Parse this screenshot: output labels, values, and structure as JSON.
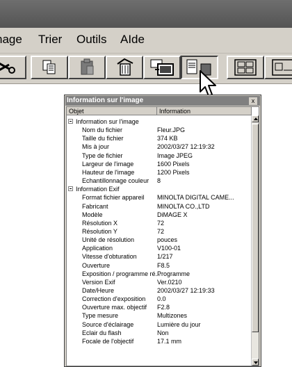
{
  "menu": {
    "items": [
      "nage",
      "Trier",
      "Outils",
      "AIde"
    ]
  },
  "dialog": {
    "title": "Information sur l'image",
    "close": "x",
    "columns": [
      "Objet",
      "Information"
    ],
    "rows": [
      {
        "group": true,
        "name": "Information sur l'image",
        "value": ""
      },
      {
        "name": "Nom du fichier",
        "value": "Fleur.JPG"
      },
      {
        "name": "Taille du fichier",
        "value": "374 KB"
      },
      {
        "name": "Mis à jour",
        "value": "2002/03/27 12:19:32"
      },
      {
        "name": "Type de fichier",
        "value": "Image JPEG"
      },
      {
        "name": "Largeur de l'image",
        "value": "1600 Pixels"
      },
      {
        "name": "Hauteur de l'image",
        "value": "1200 Pixels"
      },
      {
        "name": "Echantillonnage couleur",
        "value": "8"
      },
      {
        "group": true,
        "name": "Information Exif",
        "value": ""
      },
      {
        "name": "Format fichier appareil",
        "value": "MINOLTA DIGITAL CAME..."
      },
      {
        "name": "Fabricant",
        "value": "MINOLTA CO.,LTD"
      },
      {
        "name": "Modèle",
        "value": "DiMAGE X"
      },
      {
        "name": "Résolution X",
        "value": "72"
      },
      {
        "name": "Résolution Y",
        "value": "72"
      },
      {
        "name": "Unité de résolution",
        "value": "pouces"
      },
      {
        "name": "Application",
        "value": "V100-01"
      },
      {
        "name": "Vitesse d'obturation",
        "value": "1/217"
      },
      {
        "name": "Ouverture",
        "value": "F8.5"
      },
      {
        "name": "Exposition / programme ré...",
        "value": "Programme"
      },
      {
        "name": "Version Exif",
        "value": "Ver.0210"
      },
      {
        "name": "Date/Heure",
        "value": "2002/03/27 12:19:33"
      },
      {
        "name": "Correction d'exposition",
        "value": "0.0"
      },
      {
        "name": "Ouverture max. objectif",
        "value": "F2.8"
      },
      {
        "name": "Type mesure",
        "value": "Multizones"
      },
      {
        "name": "Source d'éclairage",
        "value": "Lumière du jour"
      },
      {
        "name": "Eclair du flash",
        "value": "Non"
      },
      {
        "name": "Focale de l'objectif",
        "value": "17.1 mm"
      }
    ]
  },
  "colors": {
    "chrome": "#d4d0c8",
    "titlebar": "#5a5a5a",
    "dialog_title": "#808080"
  }
}
